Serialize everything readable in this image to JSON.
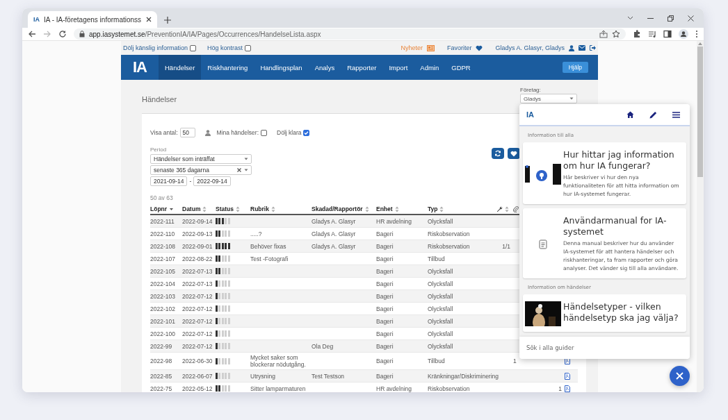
{
  "browser": {
    "favicon": "IA",
    "tab_title": "IA - IA-företagens informationss",
    "url_domain": "app.iasystemet.se",
    "url_path": "/PreventionIA/IA/Pages/Occurrences/HandelseLista.aspx"
  },
  "top_links": {
    "options": [
      {
        "label": "Dölj känslig information",
        "checked": false
      },
      {
        "label": "Hög kontrast",
        "checked": false
      }
    ],
    "news": "Nyheter",
    "favorites": "Favoriter",
    "user": "Gladys A. Glasyr, Gladys"
  },
  "nav": {
    "logo": "IA",
    "items": [
      {
        "label": "Händelser",
        "selected": true
      },
      {
        "label": "Riskhantering",
        "selected": false
      },
      {
        "label": "Handlingsplan",
        "selected": false
      },
      {
        "label": "Analys",
        "selected": false
      },
      {
        "label": "Rapporter",
        "selected": false
      },
      {
        "label": "Import",
        "selected": false
      },
      {
        "label": "Admin",
        "selected": false
      },
      {
        "label": "GDPR",
        "selected": false
      }
    ],
    "help": "Hjälp"
  },
  "company": {
    "label": "Företag:",
    "value": "Gladys"
  },
  "heading": "Händelser",
  "filters": {
    "show_label": "Visa antal:",
    "show_value": "50",
    "mine_label": "Mina händelser:",
    "mine_checked": false,
    "hide_done_label": "Dölj klara",
    "hide_done_checked": true,
    "period_label": "Period",
    "period_type": "Händelser som inträffat",
    "period_range": "senaste 365 dagarna",
    "date_from": "2021-09-14",
    "date_sep": "-",
    "date_to": "2022-09-14"
  },
  "result_count": "50 av 63",
  "table": {
    "columns": [
      {
        "kind": "text",
        "label": "Löpnr",
        "sorted": true
      },
      {
        "kind": "text",
        "label": "Datum",
        "sorted": false
      },
      {
        "kind": "text",
        "label": "Status",
        "sorted": false
      },
      {
        "kind": "text",
        "label": "Rubrik",
        "sorted": false
      },
      {
        "kind": "text",
        "label": "Skadad/Rapportör",
        "sorted": false
      },
      {
        "kind": "text",
        "label": "Enhet",
        "sorted": false
      },
      {
        "kind": "text",
        "label": "Typ",
        "sorted": false
      },
      {
        "kind": "wrench",
        "sorted": false
      },
      {
        "kind": "paperclip"
      }
    ],
    "rows": [
      {
        "number": "2022-111",
        "date": "2022-09-14",
        "level": 0.6,
        "person": "Gladys A. Glasyr",
        "unit": "HR avdelning",
        "type": "Olycksfall"
      },
      {
        "number": "2022-110",
        "date": "2022-09-13",
        "level": 0.4,
        "title": ".....?",
        "person": "Gladys A. Glasyr",
        "unit": "Bageri",
        "type": "Riskobservation"
      },
      {
        "number": "2022-108",
        "date": "2022-09-01",
        "level": 1,
        "title": "Behöver fixas",
        "person": "Gladys A. Glasyr",
        "unit": "Bageri",
        "type": "Riskobservation",
        "count_1": "1/1"
      },
      {
        "number": "2022-107",
        "date": "2022-08-22",
        "level": 0.4,
        "title": "Test -Fotografi",
        "unit": "Bageri",
        "type": "Tillbud"
      },
      {
        "number": "2022-105",
        "date": "2022-07-13",
        "level": 0.4,
        "unit": "Bageri",
        "type": "Olycksfall"
      },
      {
        "number": "2022-104",
        "date": "2022-07-13",
        "level": 0.2,
        "unit": "Bageri",
        "type": "Olycksfall"
      },
      {
        "number": "2022-103",
        "date": "2022-07-12",
        "level": 0.2,
        "unit": "Bageri",
        "type": "Olycksfall"
      },
      {
        "number": "2022-102",
        "date": "2022-07-12",
        "level": 0.2,
        "unit": "Bageri",
        "type": "Olycksfall"
      },
      {
        "number": "2022-101",
        "date": "2022-07-12",
        "level": 0.2,
        "unit": "Bageri",
        "type": "Olycksfall"
      },
      {
        "number": "2022-100",
        "date": "2022-07-12",
        "level": 0.2,
        "unit": "Bageri",
        "type": "Olycksfall"
      },
      {
        "number": "2022-99",
        "date": "2022-07-12",
        "level": 0.2,
        "person": "Ola Deg",
        "unit": "Bageri",
        "type": "Olycksfall"
      },
      {
        "number": "2022-98",
        "date": "2022-06-30",
        "level": 0.2,
        "title": "Mycket saker som blockerar nödutgång.",
        "unit": "Bageri",
        "type": "Tillbud",
        "count_2": "1",
        "pdf": true
      },
      {
        "number": "2022-85",
        "date": "2022-06-07",
        "level": 0.2,
        "title": "Utrysning",
        "person": "Test Testson",
        "unit": "Bageri",
        "type": "Kränkningar/Diskriminering",
        "pdf": true
      },
      {
        "number": "2022-75",
        "date": "2022-05-12",
        "level": 0.4,
        "title": "Sitter lamparmaturen",
        "unit": "HR avdelning",
        "type": "Riskobservation",
        "count_3": "1",
        "pdf": true
      }
    ]
  },
  "help_panel": {
    "logo": "IA",
    "sections": [
      {
        "title": "Information till alla",
        "cards": [
          {
            "kind": "picture",
            "title": "Hur hittar jag information om hur IA fungerar?",
            "text": "Här beskriver vi hur den nya funktionaliteten för att hitta information om hur IA-systemet fungerar."
          },
          {
            "kind": "document",
            "title": "Användarmanual for IA-systemet",
            "text": "Denna manual beskriver hur du använder IA-systemet för att hantera händelser och riskhanteringar, ta fram rapporter och göra analyser. Det vänder sig till alla användare."
          }
        ]
      },
      {
        "title": "Information om händelser",
        "cards": [
          {
            "kind": "picture",
            "title": "Händelsetyper - vilken händelsetyp ska jag välja?"
          }
        ]
      }
    ],
    "search_placeholder": "Sök i alla guider"
  }
}
